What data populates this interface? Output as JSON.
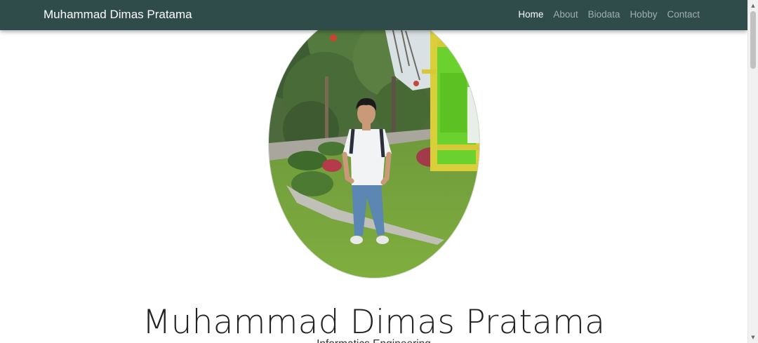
{
  "navbar": {
    "brand": "Muhammad Dimas Pratama",
    "links": [
      {
        "label": "Home",
        "active": true
      },
      {
        "label": "About",
        "active": false
      },
      {
        "label": "Biodata",
        "active": false
      },
      {
        "label": "Hobby",
        "active": false
      },
      {
        "label": "Contact",
        "active": false
      }
    ],
    "background": "#2f4b4a"
  },
  "hero": {
    "name": "Muhammad Dimas Pratama",
    "subtitle": "Informatics Engineering",
    "photo_icon": "profile-photo"
  }
}
